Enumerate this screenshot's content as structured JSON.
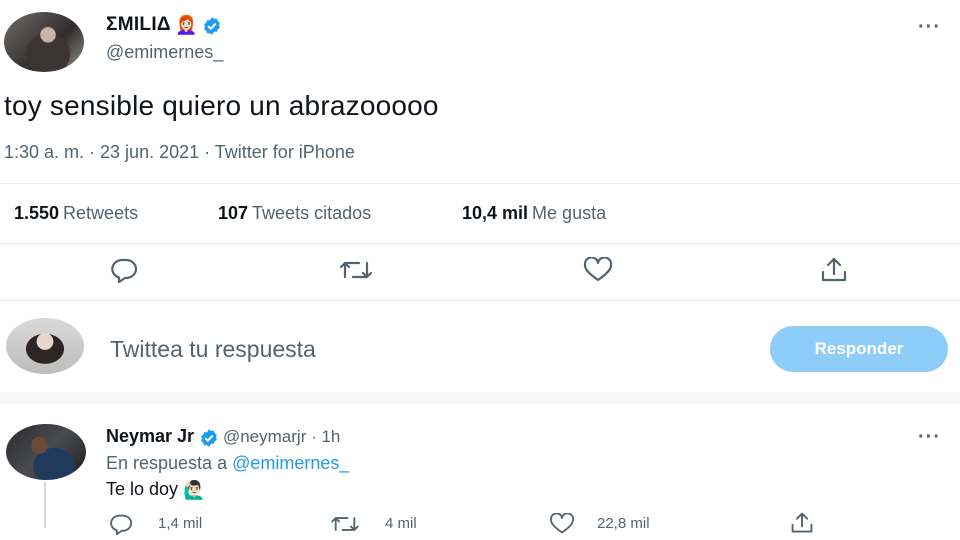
{
  "tweet": {
    "display_name": "ƩMILIΔ",
    "name_emoji": "👩🏻‍🦰",
    "handle": "@emimernes_",
    "text": "toy sensible quiero un abrazooooo",
    "meta": "1:30 a. m. · 23 jun. 2021 · Twitter for iPhone",
    "more_label": "···",
    "stats": [
      {
        "count": "1.550",
        "label": "Retweets"
      },
      {
        "count": "107",
        "label": "Tweets citados"
      },
      {
        "count": "10,4 mil",
        "label": "Me gusta"
      }
    ],
    "actions": [
      "reply-icon",
      "retweet-icon",
      "like-icon",
      "share-icon"
    ]
  },
  "compose": {
    "placeholder": "Twittea tu respuesta",
    "button_label": "Responder"
  },
  "reply": {
    "display_name": "Neymar Jr",
    "handle_time": "@neymarjr · 1h",
    "in_reply_prefix": "En respuesta a",
    "in_reply_handle": "@emimernes_",
    "text": "Te lo doy",
    "text_emoji": "🙋🏻‍♂️",
    "more_label": "···",
    "counts": {
      "reply": "1,4 mil",
      "retweet": "4 mil",
      "like": "22,8 mil"
    }
  },
  "colors": {
    "accent": "#1d9bf0",
    "button_disabled": "#8ecdf8",
    "secondary_text": "#536471"
  }
}
